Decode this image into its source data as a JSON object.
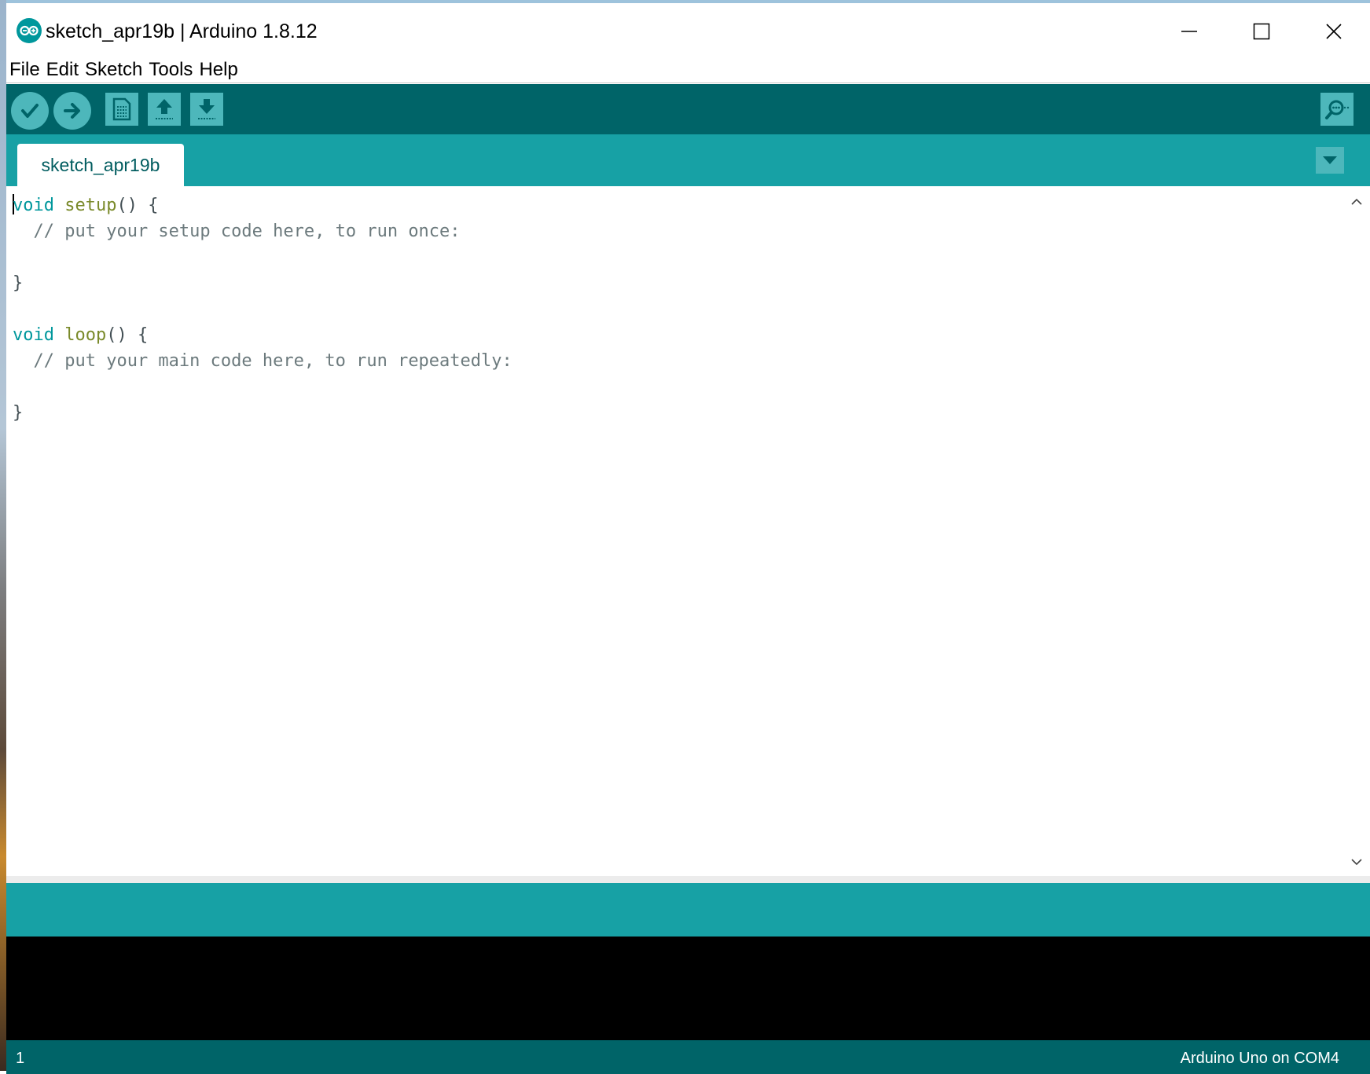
{
  "window": {
    "title": "sketch_apr19b | Arduino 1.8.12",
    "controls": [
      "minimize",
      "maximize",
      "close"
    ]
  },
  "menu": {
    "items": [
      "File",
      "Edit",
      "Sketch",
      "Tools",
      "Help"
    ]
  },
  "toolbar": {
    "buttons": [
      {
        "name": "verify",
        "icon": "check-icon"
      },
      {
        "name": "upload",
        "icon": "arrow-right-icon"
      },
      {
        "name": "new",
        "icon": "document-icon"
      },
      {
        "name": "open",
        "icon": "arrow-up-icon"
      },
      {
        "name": "save",
        "icon": "arrow-down-icon"
      }
    ],
    "serial_monitor_icon": "magnifier-icon"
  },
  "tabs": {
    "active": "sketch_apr19b"
  },
  "editor": {
    "lines": [
      {
        "kw": "void",
        "fn": "setup",
        "rest": "() {"
      },
      {
        "comment": "  // put your setup code here, to run once:"
      },
      {
        "text": ""
      },
      {
        "text": "}"
      },
      {
        "text": ""
      },
      {
        "kw": "void",
        "fn": "loop",
        "rest": "() {"
      },
      {
        "comment": "  // put your main code here, to run repeatedly:"
      },
      {
        "text": ""
      },
      {
        "text": "}"
      }
    ]
  },
  "footer": {
    "line_number": "1",
    "board": "Arduino Uno on COM4"
  },
  "colors": {
    "toolbar": "#006468",
    "tabbar": "#17a1a5",
    "button": "#4db7bb",
    "keyword": "#00979c"
  }
}
